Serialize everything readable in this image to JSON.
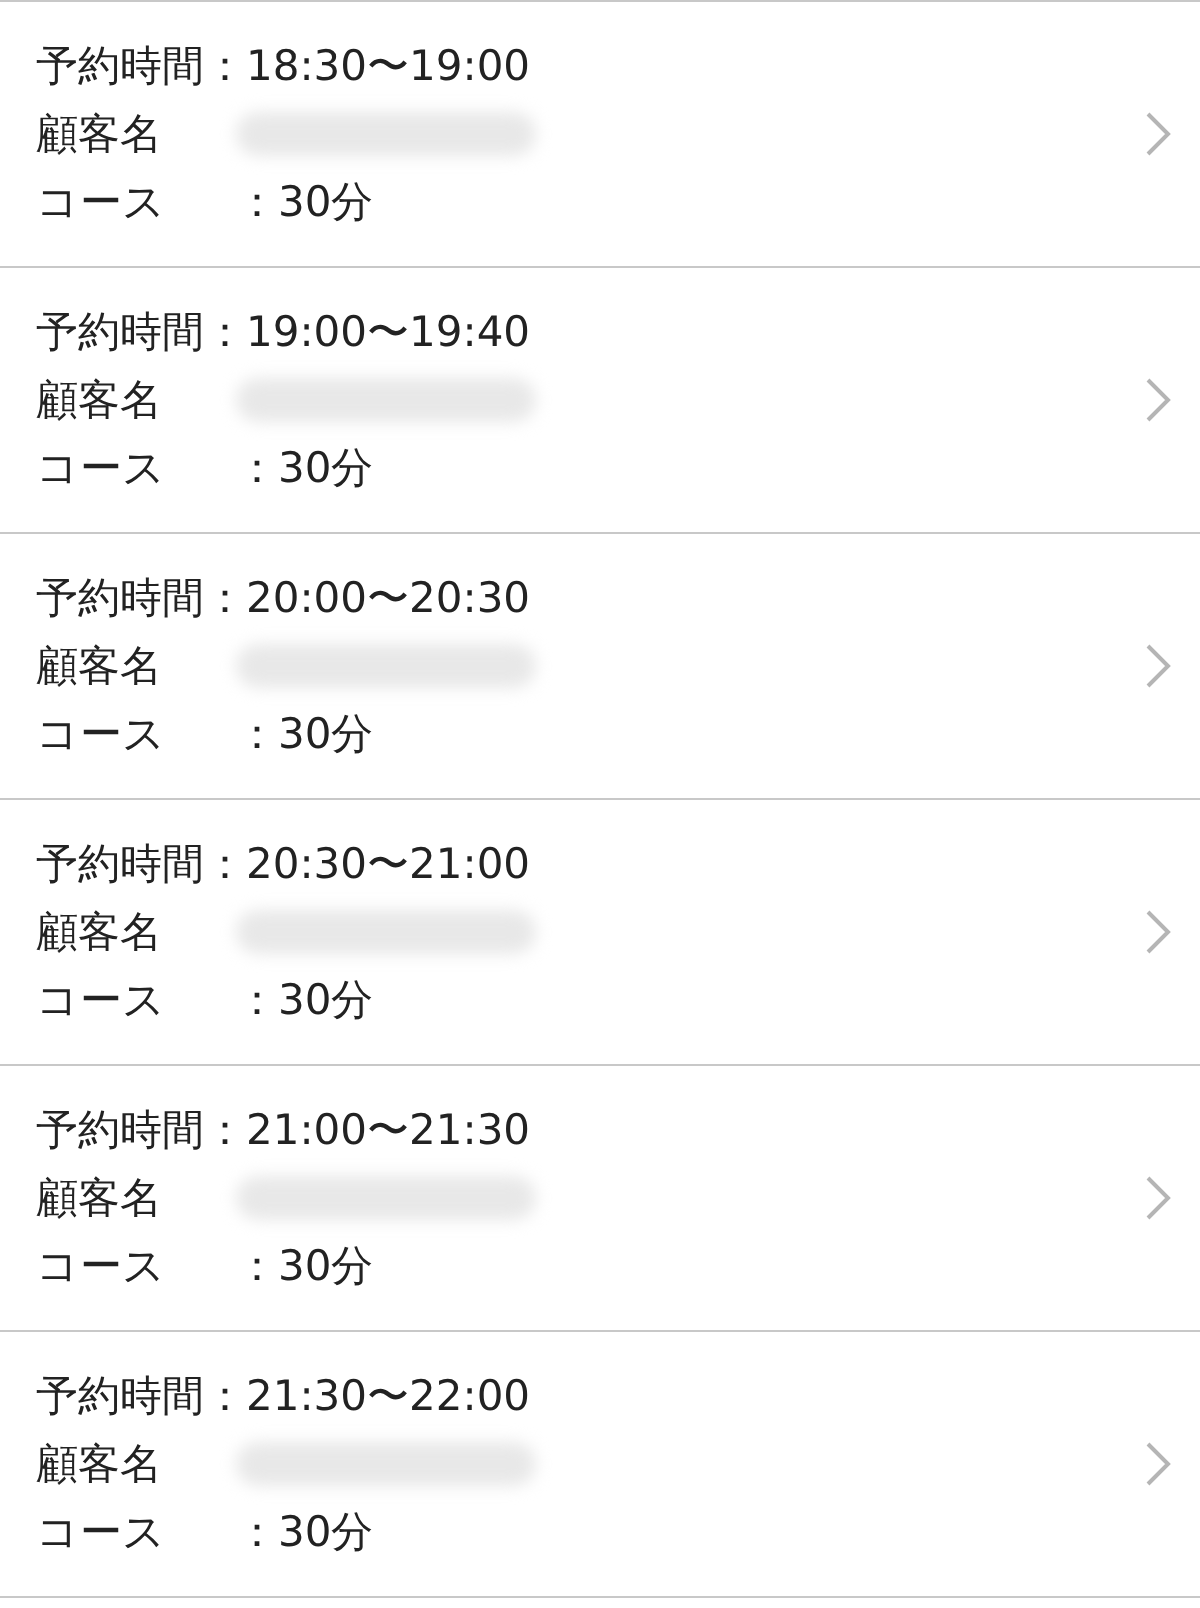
{
  "reservations": [
    {
      "time": "予約時間：18:30〜19:00",
      "customer_label": "顧客名",
      "course_label": "コース",
      "course_value": "：30分"
    },
    {
      "time": "予約時間：19:00〜19:40",
      "customer_label": "顧客名",
      "course_label": "コース",
      "course_value": "：30分"
    },
    {
      "time": "予約時間：20:00〜20:30",
      "customer_label": "顧客名",
      "course_label": "コース",
      "course_value": "：30分"
    },
    {
      "time": "予約時間：20:30〜21:00",
      "customer_label": "顧客名",
      "course_label": "コース",
      "course_value": "：30分"
    },
    {
      "time": "予約時間：21:00〜21:30",
      "customer_label": "顧客名",
      "course_label": "コース",
      "course_value": "：30分"
    },
    {
      "time": "予約時間：21:30〜22:00",
      "customer_label": "顧客名",
      "course_label": "コース",
      "course_value": "：30分"
    }
  ]
}
